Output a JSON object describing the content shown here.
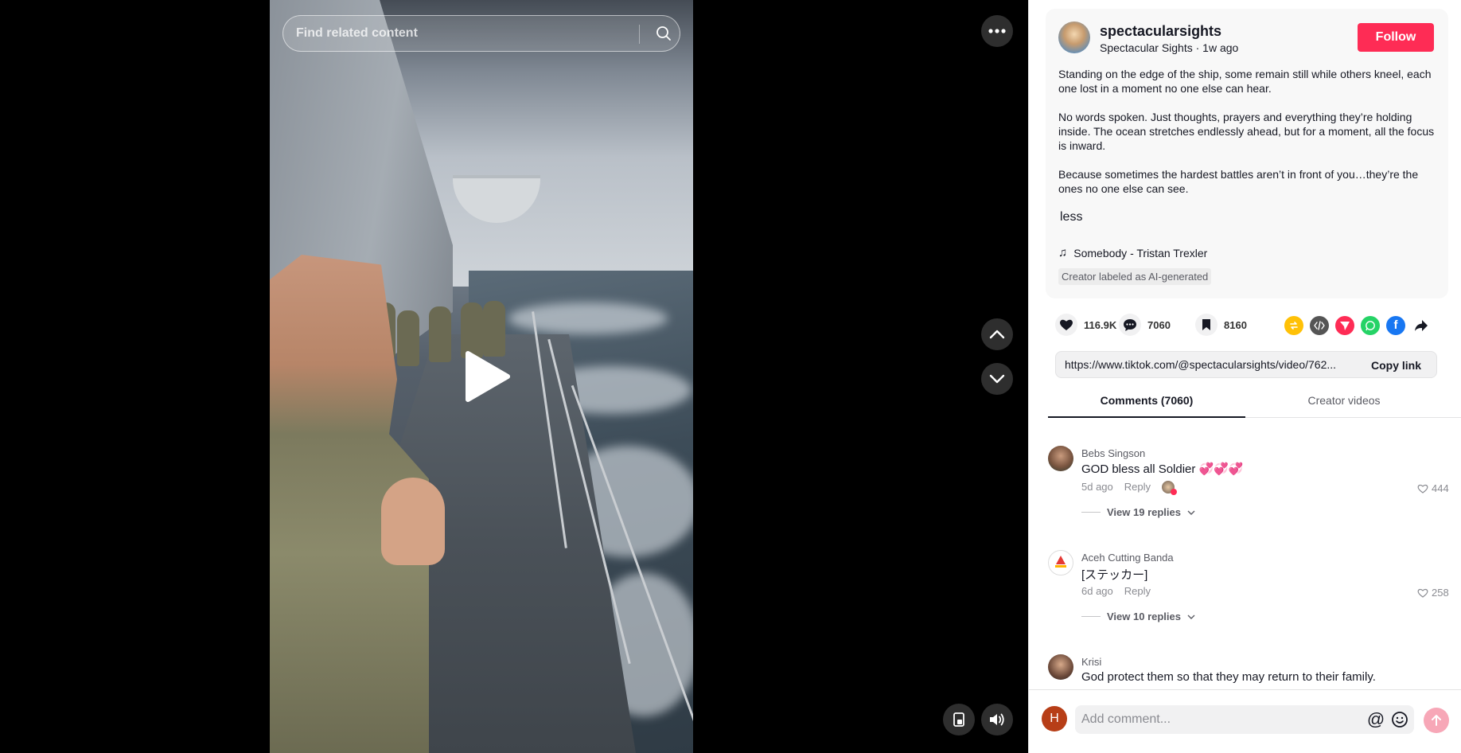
{
  "search": {
    "placeholder": "Find related content"
  },
  "creator": {
    "handle": "spectacularsights",
    "display_name": "Spectacular Sights",
    "posted": "1w ago",
    "meta": "Spectacular Sights · 1w ago",
    "follow_label": "Follow"
  },
  "description": {
    "paragraphs": [
      "Standing on the edge of the ship, some remain still while others kneel, each one lost in a moment no one else can hear.",
      "No words spoken. Just thoughts, prayers and everything they’re holding inside. The ocean stretches endlessly ahead, but for a moment, all the focus is inward.",
      "Because sometimes the hardest battles aren’t in front of you…they’re the ones no one else can see."
    ],
    "less_label": "less",
    "music": "Somebody - Tristan Trexler",
    "ai_label": "Creator labeled as AI-generated"
  },
  "stats": {
    "likes": "116.9K",
    "comments": "7060",
    "saves": "8160"
  },
  "share_targets": [
    "repost-icon",
    "embed-icon",
    "send-icon",
    "whatsapp-icon",
    "facebook-icon",
    "share-arrow-icon"
  ],
  "colors": {
    "accent": "#fe2c55",
    "repost": "#ffc107",
    "embed": "#555555",
    "send": "#fe2c55",
    "whatsapp": "#25d366",
    "facebook": "#1877f2"
  },
  "link": {
    "url": "https://www.tiktok.com/@spectacularsights/video/762...",
    "copy_label": "Copy link"
  },
  "tabs": [
    {
      "label": "Comments (7060)"
    },
    {
      "label": "Creator videos"
    }
  ],
  "comments": [
    {
      "name": "Bebs Singson",
      "text": "GOD bless all Soldier 💞💞💞",
      "time": "5d ago",
      "reply": "Reply",
      "likes": "444",
      "view_replies": "View 19 replies"
    },
    {
      "name": "Aceh Cutting Banda",
      "text": "[ステッカー]",
      "time": "6d ago",
      "reply": "Reply",
      "likes": "258",
      "view_replies": "View 10 replies"
    },
    {
      "name": "Krisi",
      "text": "God protect them so that they may return to their family.",
      "time": "",
      "reply": "",
      "likes": "",
      "view_replies": ""
    }
  ],
  "comment_bar": {
    "user_initial": "H",
    "placeholder": "Add comment...",
    "mention": "@"
  }
}
